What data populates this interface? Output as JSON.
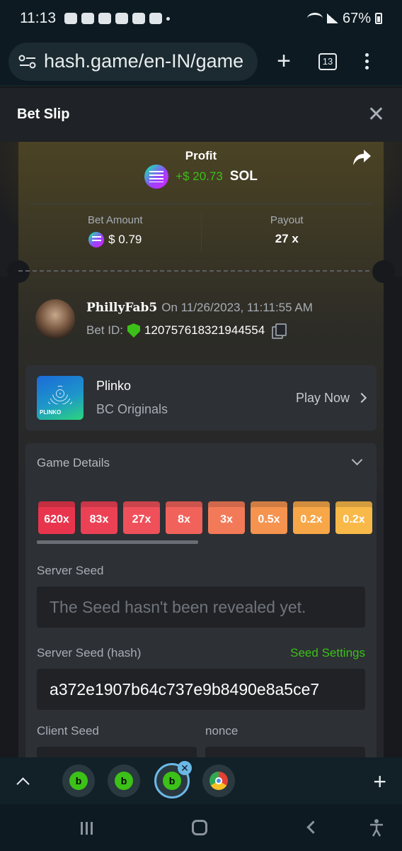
{
  "status_bar": {
    "time": "11:13",
    "battery": "67%"
  },
  "browser": {
    "url": "hash.game/en-IN/game",
    "tab_count": "13"
  },
  "bet_slip": {
    "title": "Bet Slip",
    "profit_label": "Profit",
    "profit_amount": "+$ 20.73",
    "profit_currency": "SOL",
    "bet_amount_label": "Bet Amount",
    "bet_amount": "$ 0.79",
    "payout_label": "Payout",
    "payout": "27 x",
    "username": "PhillyFab5",
    "played_on": "On 11/26/2023, 11:11:55 AM",
    "bet_id_label": "Bet ID:",
    "bet_id": "120757618321944554",
    "game_name": "Plinko",
    "game_provider": "BC Originals",
    "play_now": "Play Now",
    "thumb_tag": "PLINKO",
    "details_title": "Game Details",
    "multipliers": [
      {
        "label": "620x",
        "color": "#e8354d"
      },
      {
        "label": "83x",
        "color": "#ec4155"
      },
      {
        "label": "27x",
        "color": "#ef505a"
      },
      {
        "label": "8x",
        "color": "#f1625b"
      },
      {
        "label": "3x",
        "color": "#f37a58"
      },
      {
        "label": "0.5x",
        "color": "#f5934f"
      },
      {
        "label": "0.2x",
        "color": "#f7a748"
      },
      {
        "label": "0.2x",
        "color": "#f9b948"
      }
    ],
    "server_seed_label": "Server Seed",
    "server_seed_placeholder": "The Seed hasn't been revealed yet.",
    "server_seed_hash_label": "Server Seed (hash)",
    "seed_settings": "Seed Settings",
    "server_seed_hash": "a372e1907b64c737e9b8490e8a5ce7",
    "client_seed_label": "Client Seed",
    "nonce_label": "nonce"
  },
  "colors": {
    "accent_green": "#3bc117",
    "card_bg": "#2d3035"
  }
}
